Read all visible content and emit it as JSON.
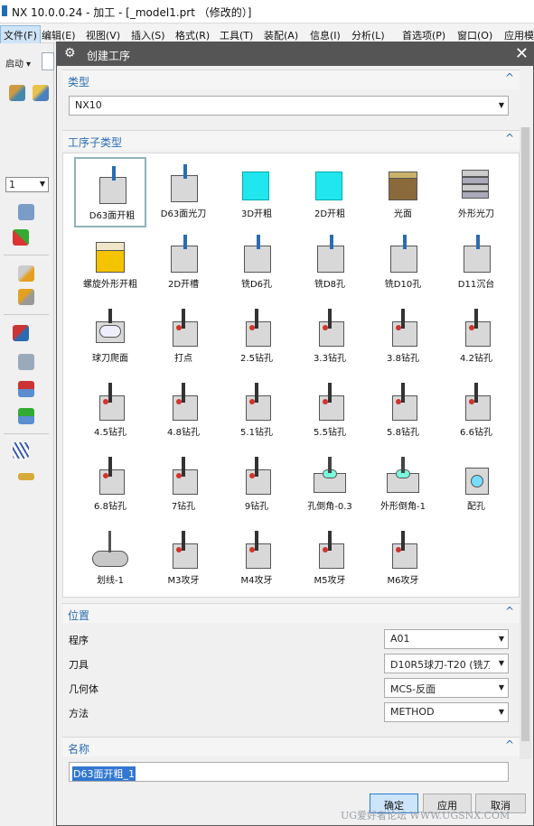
{
  "app": {
    "title": "NX 10.0.0.24 - 加工 - [_model1.prt （修改的）]"
  },
  "menu": [
    "文件(F)",
    "编辑(E)",
    "视图(V)",
    "插入(S)",
    "格式(R)",
    "工具(T)",
    "装配(A)",
    "信息(I)",
    "分析(L)",
    "首选项(P)",
    "窗口(O)",
    "应用模"
  ],
  "left_toolbar": {
    "start_label": "启动",
    "number_value": "1"
  },
  "dialog": {
    "title": "创建工序",
    "sections": {
      "type": "类型",
      "subtype": "工序子类型",
      "location": "位置",
      "name": "名称"
    },
    "type_value": "NX10",
    "operations": [
      "D63面开粗",
      "D63面光刀",
      "3D开粗",
      "2D开粗",
      "光面",
      "外形光刀",
      "螺旋外形开粗",
      "2D开槽",
      "铣D6孔",
      "铣D8孔",
      "铣D10孔",
      "D11沉台",
      "球刀爬面",
      "打点",
      "2.5钻孔",
      "3.3钻孔",
      "3.8钻孔",
      "4.2钻孔",
      "4.5钻孔",
      "4.8钻孔",
      "5.1钻孔",
      "5.5钻孔",
      "5.8钻孔",
      "6.6钻孔",
      "6.8钻孔",
      "7钻孔",
      "9钻孔",
      "孔倒角-0.3",
      "外形倒角-1",
      "配孔",
      "划线-1",
      "M3攻牙",
      "M4攻牙",
      "M5攻牙",
      "M6攻牙"
    ],
    "selected_operation": "D63面开粗",
    "location": {
      "program_label": "程序",
      "program_value": "A01",
      "tool_label": "刀具",
      "tool_value": "D10R5球刀-T20 (铣刀",
      "geometry_label": "几何体",
      "geometry_value": "MCS-反面",
      "method_label": "方法",
      "method_value": "METHOD"
    },
    "name_value": "D63面开粗_1",
    "buttons": {
      "ok": "确定",
      "apply": "应用",
      "cancel": "取消"
    },
    "chevron_up": "^",
    "close_glyph": "✕",
    "gear_glyph": "⚙"
  },
  "watermark": "UG爱好者论坛 WWW.UGSNX.COM",
  "colors": {
    "dialog_header": "#555555",
    "accent_blue": "#2b6cb0",
    "selection": "#3277d1",
    "block_gray": "#d8d8d8",
    "block_cyan": "#22e6ee",
    "block_yellow": "#f5c400",
    "block_brown": "#8a6a3a",
    "drill_red": "#d0342c"
  }
}
